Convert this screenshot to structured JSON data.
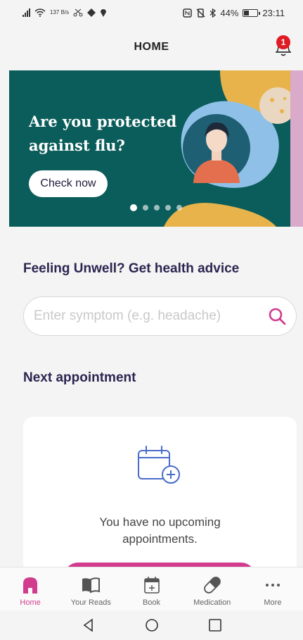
{
  "status_bar": {
    "net_speed": "137 B/s",
    "battery": "44%",
    "battery_level": 0.44,
    "time": "23:11"
  },
  "header": {
    "title": "HOME",
    "notification_count": "1"
  },
  "banner": {
    "title": "Are you protected against flu?",
    "cta_label": "Check now",
    "slide_count": 5,
    "active_slide": 0,
    "colors": {
      "background": "#0b5d5b",
      "accent": "#e8b34a"
    }
  },
  "health_advice": {
    "title": "Feeling Unwell? Get health advice",
    "search_placeholder": "Enter symptom (e.g. headache)",
    "search_value": ""
  },
  "appointments": {
    "title": "Next appointment",
    "empty_text": "You have no upcoming appointments."
  },
  "bottom_nav": {
    "items": [
      {
        "label": "Home",
        "icon": "home-icon",
        "active": true
      },
      {
        "label": "Your Reads",
        "icon": "book-open-icon",
        "active": false
      },
      {
        "label": "Book",
        "icon": "calendar-plus-icon",
        "active": false
      },
      {
        "label": "Medication",
        "icon": "pill-icon",
        "active": false
      },
      {
        "label": "More",
        "icon": "more-dots-icon",
        "active": false
      }
    ]
  },
  "theme": {
    "accent": "#d23c8f",
    "heading": "#2b2550",
    "icon_blue": "#4a6cc9"
  }
}
